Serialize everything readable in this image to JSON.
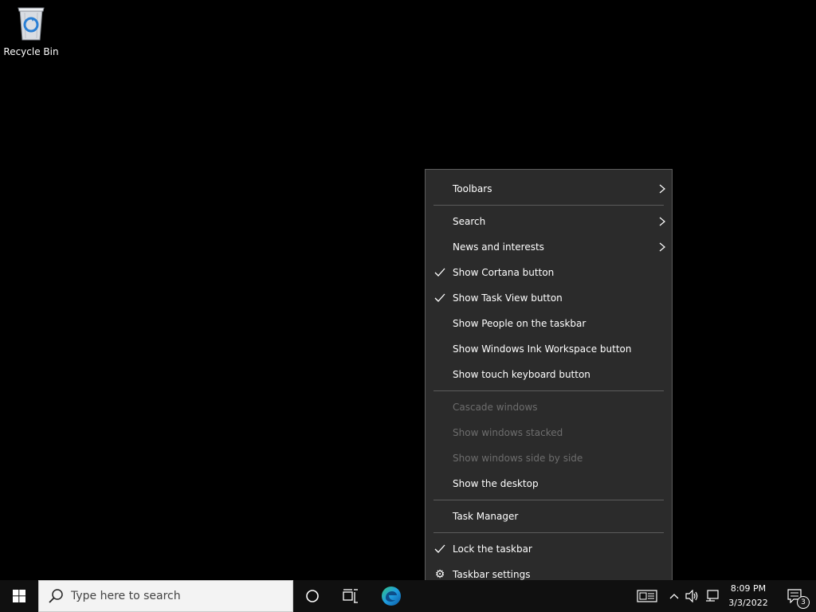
{
  "desktop": {
    "icons": [
      {
        "label": "Recycle Bin",
        "icon": "recycle-bin-icon"
      }
    ]
  },
  "context_menu": {
    "items": [
      {
        "label": "Toolbars",
        "checked": false,
        "submenu": true,
        "disabled": false
      },
      {
        "separator": true
      },
      {
        "label": "Search",
        "checked": false,
        "submenu": true,
        "disabled": false
      },
      {
        "label": "News and interests",
        "checked": false,
        "submenu": true,
        "disabled": false
      },
      {
        "label": "Show Cortana button",
        "checked": true,
        "submenu": false,
        "disabled": false
      },
      {
        "label": "Show Task View button",
        "checked": true,
        "submenu": false,
        "disabled": false
      },
      {
        "label": "Show People on the taskbar",
        "checked": false,
        "submenu": false,
        "disabled": false
      },
      {
        "label": "Show Windows Ink Workspace button",
        "checked": false,
        "submenu": false,
        "disabled": false
      },
      {
        "label": "Show touch keyboard button",
        "checked": false,
        "submenu": false,
        "disabled": false
      },
      {
        "separator": true
      },
      {
        "label": "Cascade windows",
        "checked": false,
        "submenu": false,
        "disabled": true
      },
      {
        "label": "Show windows stacked",
        "checked": false,
        "submenu": false,
        "disabled": true
      },
      {
        "label": "Show windows side by side",
        "checked": false,
        "submenu": false,
        "disabled": true
      },
      {
        "label": "Show the desktop",
        "checked": false,
        "submenu": false,
        "disabled": false
      },
      {
        "separator": true
      },
      {
        "label": "Task Manager",
        "checked": false,
        "submenu": false,
        "disabled": false
      },
      {
        "separator": true
      },
      {
        "label": "Lock the taskbar",
        "checked": true,
        "submenu": false,
        "disabled": false
      },
      {
        "label": "Taskbar settings",
        "checked": false,
        "submenu": false,
        "disabled": false,
        "icon": "gear-icon"
      }
    ]
  },
  "taskbar": {
    "search_placeholder": "Type here to search",
    "clock": {
      "time": "8:09 PM",
      "date": "3/3/2022"
    },
    "notification_count": "3",
    "colors": {
      "background": "#101010",
      "menu": "#2b2b2b",
      "accent": "#0078d7"
    }
  }
}
